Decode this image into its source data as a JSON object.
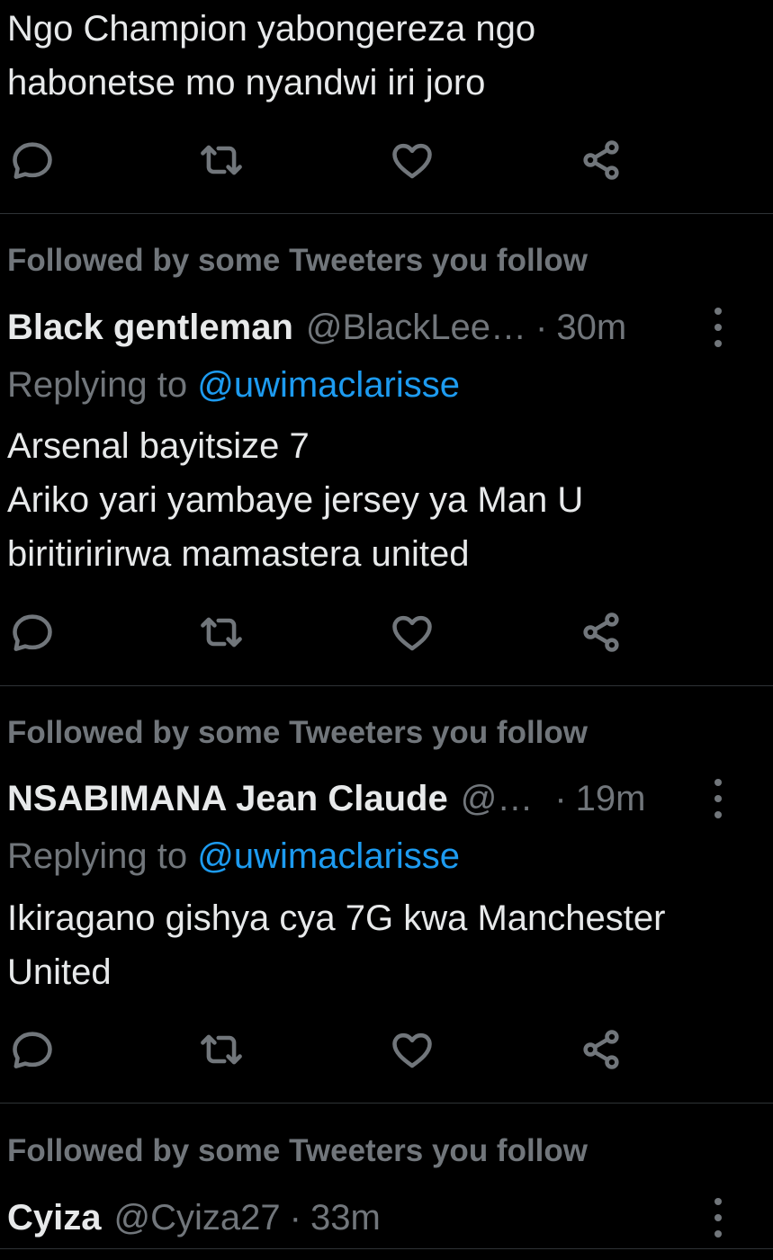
{
  "tweets": [
    {
      "text": "Ngo Champion yabongereza ngo\nhabonetse mo nyandwi iri joro"
    },
    {
      "followed_note": "Followed by some Tweeters you follow",
      "name": "Black gentleman",
      "handle": "@BlackLee…",
      "separator": "·",
      "time": "30m",
      "replying_prefix": "Replying to ",
      "replying_handle": "@uwimaclarisse",
      "text": "Arsenal bayitsize 7\nAriko yari yambaye jersey ya Man U\nbiritiririrwa mamastera united"
    },
    {
      "followed_note": "Followed by some Tweeters you follow",
      "name": "NSABIMANA Jean Claude",
      "handle": "@…",
      "separator": "·",
      "time": "19m",
      "replying_prefix": "Replying to ",
      "replying_handle": "@uwimaclarisse",
      "text": "Ikiragano gishya cya 7G kwa Manchester\nUnited"
    },
    {
      "followed_note": "Followed by some Tweeters you follow",
      "name": "Cyiza",
      "handle": "@Cyiza27",
      "separator": "·",
      "time": "33m"
    }
  ],
  "icons": {
    "reply": "reply-icon",
    "retweet": "retweet-icon",
    "like": "like-icon",
    "share": "share-icon",
    "more": "more-icon"
  },
  "colors": {
    "background": "#000000",
    "text": "#e7e9ea",
    "secondary": "#71767b",
    "link": "#1d9bf0",
    "divider": "#2f3336"
  }
}
